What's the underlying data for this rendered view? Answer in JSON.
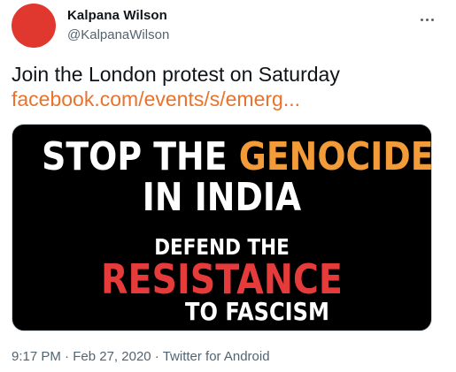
{
  "author": {
    "name": "Kalpana Wilson",
    "handle": "@KalpanaWilson",
    "avatar_color": "#e0382e"
  },
  "menu": {
    "icon": "more-horizontal-icon"
  },
  "tweet": {
    "text": "Join the London protest on Saturday",
    "link": "facebook.com/events/s/emerg...",
    "link_color": "#e8732c"
  },
  "media": {
    "line1_prefix": "STOP THE ",
    "line1_highlight": "GENOCIDE",
    "line2": "IN INDIA",
    "line3": "DEFEND THE",
    "line4": "RESISTANCE",
    "line5": "TO FASCISM",
    "background": "#000000",
    "highlight_color": "#f29b38",
    "accent_color": "#e53b3b"
  },
  "meta": {
    "time": "9:17 PM",
    "sep1": " · ",
    "date": "Feb 27, 2020",
    "sep2": " · ",
    "source": "Twitter for Android"
  }
}
